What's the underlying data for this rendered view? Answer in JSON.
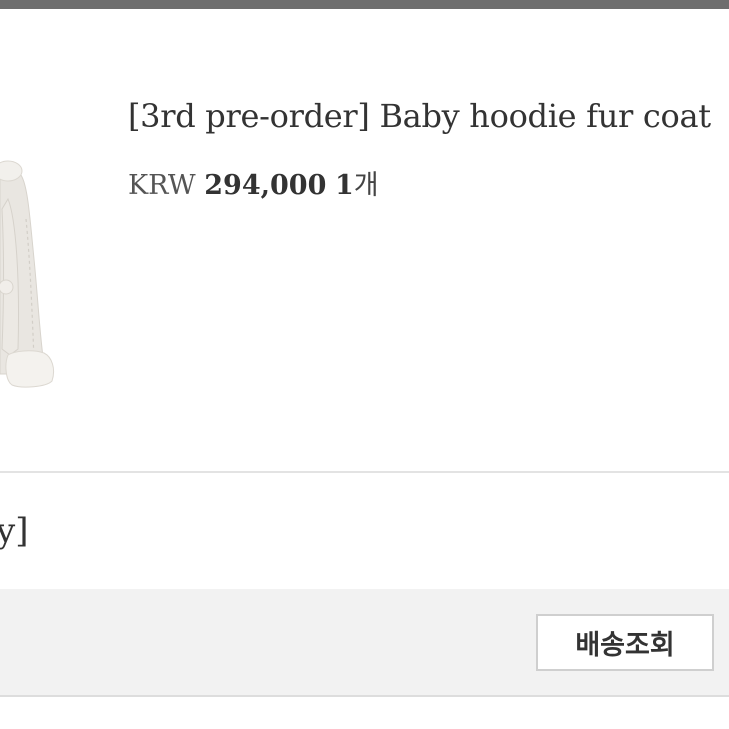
{
  "product": {
    "title": "[3rd pre-order] Baby hoodie fur coat",
    "currency": "KRW",
    "price": "294,000",
    "quantity": "1",
    "quantity_unit": "개"
  },
  "option": {
    "text": "y]"
  },
  "actions": {
    "track_delivery_label": "배송조회"
  },
  "colors": {
    "top_bar": "#6e6e6e",
    "action_bar_bg": "#f2f2f2",
    "text_primary": "#333333"
  }
}
